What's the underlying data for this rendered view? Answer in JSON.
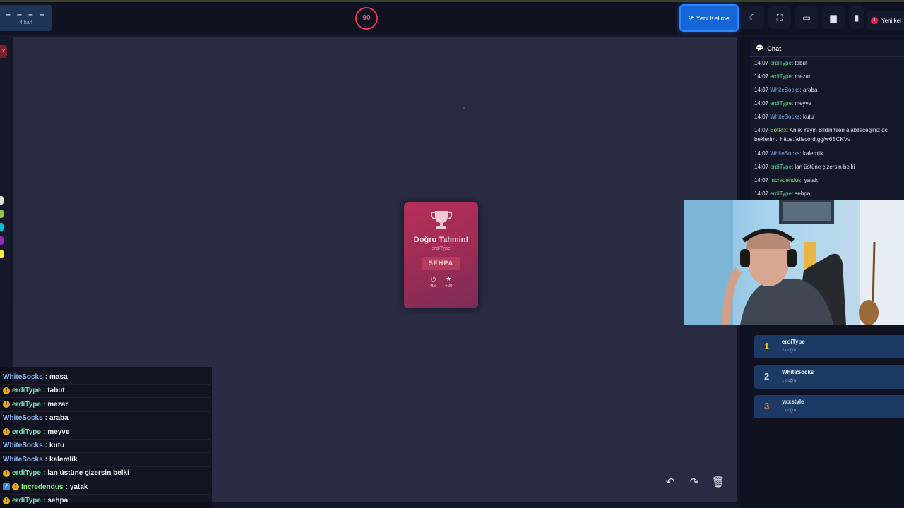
{
  "header": {
    "word_mask": "– – – –",
    "word_length": "4 harf",
    "timer": "90",
    "new_word_label": "Yeni Kelime",
    "toast_text": "Yeni kel"
  },
  "toolbar_icons": [
    "moon-icon",
    "fullscreen-icon",
    "keyboard-icon",
    "square-icon"
  ],
  "palette": [
    "#e0e0e0",
    "#8bc34a",
    "#00bcd4",
    "#9c27b0",
    "#ffeb3b"
  ],
  "card": {
    "title": "Doğru Tahmin!",
    "user": "erdiType",
    "answer": "SEHPA",
    "time": "40s",
    "points": "+20"
  },
  "canvas_actions": [
    "undo-icon",
    "redo-icon",
    "trash-icon"
  ],
  "chat_overlay": [
    {
      "name": "WhiteSocks",
      "color": "#8fb4f2",
      "msg": "masa",
      "badge": ""
    },
    {
      "name": "erdiType",
      "color": "#6fe0a9",
      "msg": "tabut",
      "badge": "!"
    },
    {
      "name": "erdiType",
      "color": "#6fe0a9",
      "msg": "mezar",
      "badge": "!"
    },
    {
      "name": "WhiteSocks",
      "color": "#8fb4f2",
      "msg": "araba",
      "badge": ""
    },
    {
      "name": "erdiType",
      "color": "#6fe0a9",
      "msg": "meyve",
      "badge": "!"
    },
    {
      "name": "WhiteSocks",
      "color": "#8fb4f2",
      "msg": "kutu",
      "badge": ""
    },
    {
      "name": "WhiteSocks",
      "color": "#8fb4f2",
      "msg": "kalemlik",
      "badge": ""
    },
    {
      "name": "erdiType",
      "color": "#6fe0a9",
      "msg": "lan üstüne çizersin belki",
      "badge": "!"
    },
    {
      "name": "Incredendus",
      "color": "#7ef06a",
      "msg": "yatak",
      "badge": "!",
      "badge2": true
    },
    {
      "name": "erdiType",
      "color": "#6fe0a9",
      "msg": "sehpa",
      "badge": "!"
    }
  ],
  "chat": {
    "title": "Chat",
    "messages": [
      {
        "time": "14:07",
        "name": "erdiType",
        "color": "#5fd39a",
        "msg": "tabut"
      },
      {
        "time": "14:07",
        "name": "erdiType",
        "color": "#5fd39a",
        "msg": "mezar"
      },
      {
        "time": "14:07",
        "name": "WhiteSocks",
        "color": "#7aa6e8",
        "msg": "araba"
      },
      {
        "time": "14:07",
        "name": "erdiType",
        "color": "#5fd39a",
        "msg": "meyve"
      },
      {
        "time": "14:07",
        "name": "WhiteSocks",
        "color": "#7aa6e8",
        "msg": "kutu"
      },
      {
        "time": "14:07",
        "name": "BotRix",
        "color": "#8ee26a",
        "msg": "Anlik Yayin Bildirimleri alabileceginiz dc beklerim.. https://discord.gg/w6SCKVv"
      },
      {
        "time": "14:07",
        "name": "WhiteSocks",
        "color": "#7aa6e8",
        "msg": "kalemlik"
      },
      {
        "time": "14:07",
        "name": "erdiType",
        "color": "#5fd39a",
        "msg": "lan üstüne çizersin belki"
      },
      {
        "time": "14:07",
        "name": "Incredendus",
        "color": "#8ee26a",
        "msg": "yatak"
      },
      {
        "time": "14:07",
        "name": "erdiType",
        "color": "#5fd39a",
        "msg": "sehpa"
      }
    ]
  },
  "leaderboard": [
    {
      "rank": "1",
      "name": "erdiType",
      "score": "2 doğru",
      "rank_color": "#f5c518"
    },
    {
      "rank": "2",
      "name": "WhiteSocks",
      "score": "1 doğru",
      "rank_color": "#d9dde8"
    },
    {
      "rank": "3",
      "name": "yxxstyle",
      "score": "1 doğru",
      "rank_color": "#e08a2c"
    }
  ]
}
